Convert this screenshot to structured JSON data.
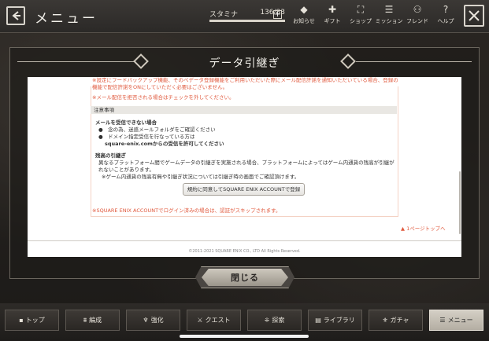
{
  "header": {
    "title": "メニュー",
    "stamina_label": "スタミナ",
    "stamina_value": "136/83",
    "stamina_fraction": 1.0,
    "plus": "+",
    "nav": [
      {
        "name": "notice-icon",
        "glyph": "◆",
        "label": "お知らせ"
      },
      {
        "name": "gift-icon",
        "glyph": "✚",
        "label": "ギフト"
      },
      {
        "name": "shop-icon",
        "glyph": "⛶",
        "label": "ショップ"
      },
      {
        "name": "mission-icon",
        "glyph": "☰",
        "label": "ミッション"
      },
      {
        "name": "friend-icon",
        "glyph": "⚇",
        "label": "フレンド"
      },
      {
        "name": "help-icon",
        "glyph": "?",
        "label": "ヘルプ"
      }
    ]
  },
  "dialog": {
    "title": "データ引継ぎ",
    "red_line1": "※設定にフードバックアップ機能、そのペデータ登録機能をご利用いただいた際にメール配信許諾を通知いただいている場合、登録の",
    "red_line2": "機能で配信許諾をONにしていただく必要はございません。",
    "red_line3": "※メール配信を拒否される場合はチェックを外してください。",
    "notes_header": "注意事項",
    "mail_title": "メールを受信できない場合",
    "mail_b1": "●　念の為、迷惑メールフォルダをご確認ください",
    "mail_b2": "●　ドメイン指定受信を行なっている方は",
    "mail_b2b": "square-enix.comからの受信を許可してください",
    "carry_title": "残高の引継ぎ",
    "carry_l1": "異なるプラットフォーム間でゲームデータの引継ぎを実施される場合、プラットフォームによってはゲーム内通貨の残高が引継が",
    "carry_l2": "れないことがあります。",
    "carry_l3": "※ゲーム内通貨の残高有無や引継ぎ状況については引継ぎ時の画面でご確認頂けます。",
    "agree_button": "規約に同意してSQUARE ENIX ACCOUNTで登録",
    "skip_note": "※SQUARE ENIX ACCOUNTでログイン済みの場合は、認証がスキップされます。",
    "page_top": "▲ 1ページトップへ",
    "copyright": "©2011-2021 SQUARE ENIX CO., LTD All Rights Reserved.",
    "close_button": "閉じる"
  },
  "tabs": [
    {
      "name": "tab-top",
      "glyph": "▪",
      "label": "トップ"
    },
    {
      "name": "tab-edit",
      "glyph": "⩩",
      "label": "編成"
    },
    {
      "name": "tab-enhance",
      "glyph": "♆",
      "label": "強化"
    },
    {
      "name": "tab-quest",
      "glyph": "⚔",
      "label": "クエスト"
    },
    {
      "name": "tab-explore",
      "glyph": "⁜",
      "label": "探索"
    },
    {
      "name": "tab-library",
      "glyph": "▤",
      "label": "ライブラリ"
    },
    {
      "name": "tab-gacha",
      "glyph": "⚜",
      "label": "ガチャ"
    },
    {
      "name": "tab-menu",
      "glyph": "☰",
      "label": "メニュー",
      "active": true
    }
  ]
}
